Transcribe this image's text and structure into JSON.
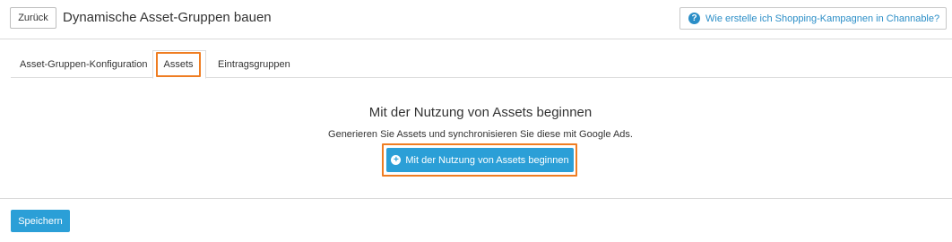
{
  "header": {
    "back_label": "Zurück",
    "title": "Dynamische Asset-Gruppen bauen",
    "help_link_label": "Wie erstelle ich Shopping-Kampagnen in Channable?",
    "help_icon": "question-circle-icon"
  },
  "tabs": [
    {
      "label": "Asset-Gruppen-Konfiguration",
      "active": false
    },
    {
      "label": "Assets",
      "active": true
    },
    {
      "label": "Eintragsgruppen",
      "active": false
    }
  ],
  "empty_state": {
    "title": "Mit der Nutzung von Assets beginnen",
    "description": "Generieren Sie Assets und synchronisieren Sie diese mit Google Ads.",
    "cta_label": "Mit der Nutzung von Assets beginnen",
    "cta_icon": "plus-circle-icon"
  },
  "footer": {
    "save_label": "Speichern"
  },
  "colors": {
    "accent": "#2b9fd7",
    "link": "#2b8ec7",
    "highlight": "#ef7d22"
  }
}
